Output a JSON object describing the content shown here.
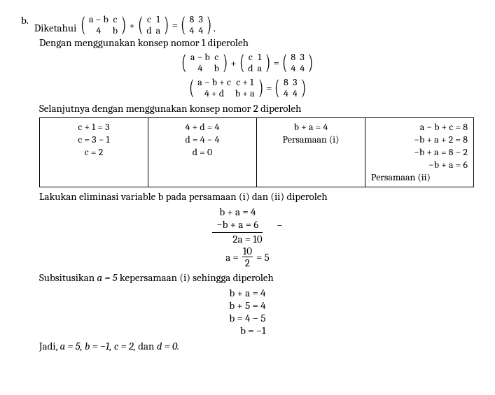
{
  "problem": {
    "label": "b.",
    "lead": "Diketahui ",
    "period": ".",
    "m1": {
      "r1c1": "a − b",
      "r1c2": "c",
      "r2c1": "4",
      "r2c2": "b"
    },
    "plus": "+",
    "m2": {
      "r1c1": "c",
      "r1c2": "1",
      "r2c1": "d",
      "r2c2": "a"
    },
    "eq": "=",
    "m3": {
      "r1c1": "8",
      "r1c2": "3",
      "r2c1": "4",
      "r2c2": "4"
    },
    "line2": "Dengan menggunakan konsep nomor 1 diperoleh",
    "sum": {
      "r1c1": "a − b + c",
      "r1c2": "c + 1",
      "r2c1": "4 + d",
      "r2c2": "b + a"
    },
    "line3": "Selanjutnya dengan menggunakan konsep nomor 2 diperoleh"
  },
  "table": {
    "col1": [
      "c + 1 = 3",
      "c = 3 − 1",
      "c = 2"
    ],
    "col2": [
      "4 + d = 4",
      "d = 4 − 4",
      "d = 0"
    ],
    "col3": [
      "b + a = 4",
      "Persamaan (i)"
    ],
    "col4": [
      "a − b + c = 8",
      "−b + a + 2 = 8",
      "−b + a = 8 − 2",
      "−b + a = 6",
      "Persamaan (ii)"
    ]
  },
  "elim": {
    "intro": "Lakukan eliminasi variable b pada persamaan (i) dan (ii) diperoleh",
    "l1": "b + a = 4",
    "l2": "−b + a = 6",
    "minus": "−",
    "l3": "2a = 10",
    "l4a": "a =",
    "l4num": "10",
    "l4den": "2",
    "l4b": "= 5"
  },
  "subs": {
    "intro_a": "Subsitusikan ",
    "intro_b": "a = 5",
    "intro_c": " kepersamaan (i) sehingga diperoleh",
    "l1": "b + a = 4",
    "l2": "b + 5 = 4",
    "l3": "b = 4 − 5",
    "l4": "b = −1"
  },
  "final": {
    "pre": "Jadi, ",
    "body": "a = 5, b = −1, c = 2, ",
    "and": "dan ",
    "last": "d = 0."
  }
}
